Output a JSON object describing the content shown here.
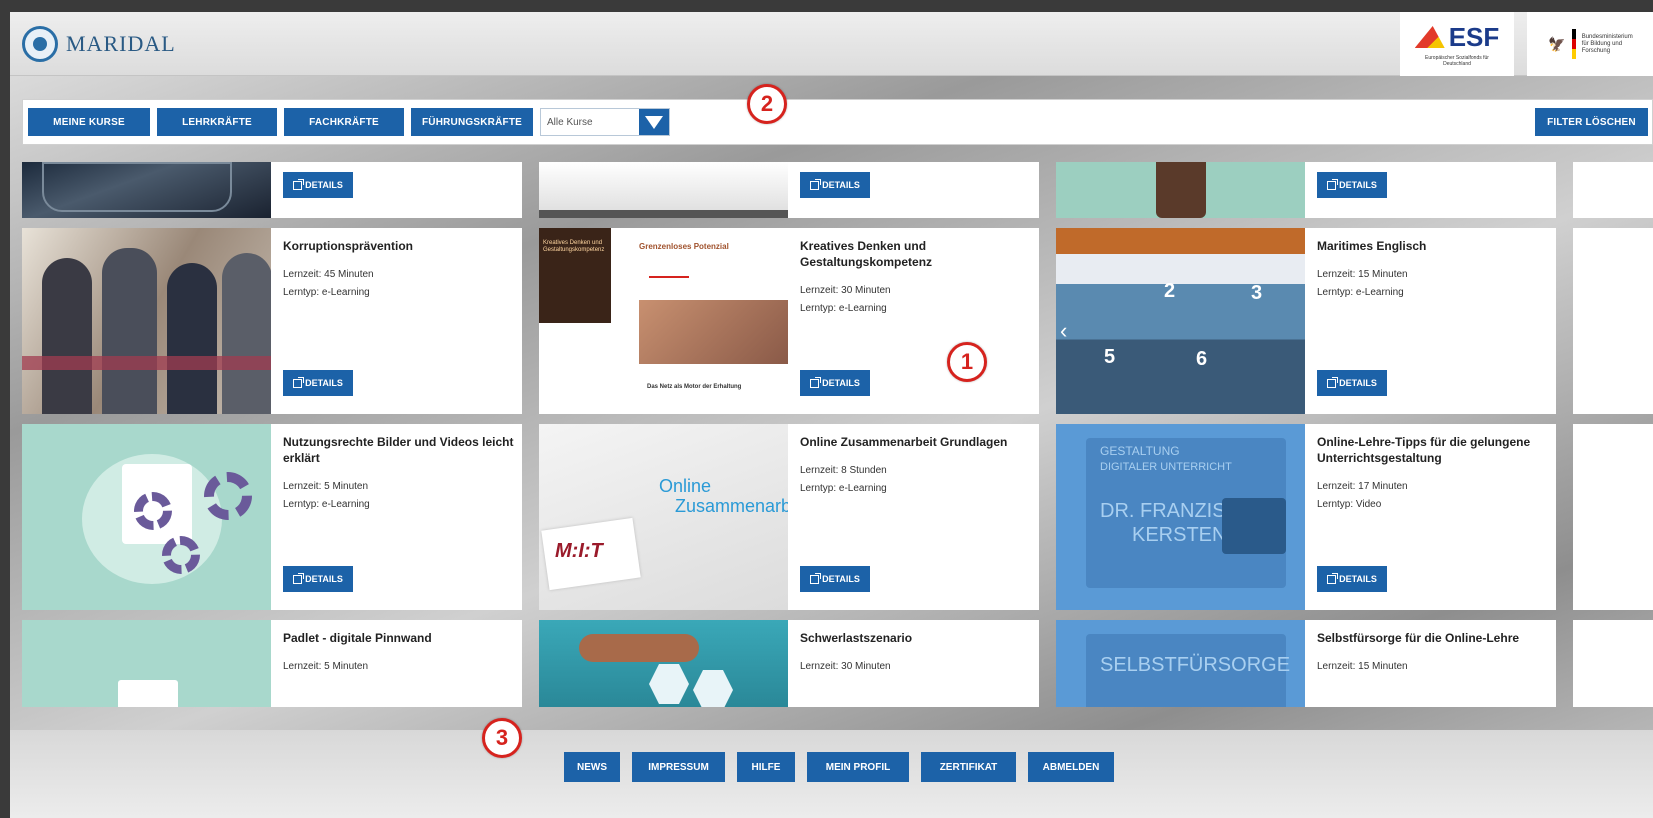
{
  "header": {
    "brand_name": "MARIDAL",
    "esf_logo": "ESF",
    "esf_subtitle": "Europäischer Sozialfonds für Deutschland",
    "bmbf_text": "Bundesministerium für Bildung und Forschung"
  },
  "filters": {
    "buttons": [
      "MEINE KURSE",
      "LEHRKRÄFTE",
      "FACHKRÄFTE",
      "FÜHRUNGSKRÄFTE"
    ],
    "select_value": "Alle Kurse",
    "clear_label": "FILTER LÖSCHEN"
  },
  "callouts": [
    "1",
    "2",
    "3"
  ],
  "details_label": "DETAILS",
  "courses": [
    {
      "title": "",
      "duration": "",
      "type": ""
    },
    {
      "title": "",
      "duration": "",
      "type": ""
    },
    {
      "title": "",
      "duration": "",
      "type": ""
    },
    {
      "title": "Korruptionsprävention",
      "duration": "Lernzeit: 45 Minuten",
      "type": "Lerntyp: e-Learning"
    },
    {
      "title": "Kreatives Denken und Gestaltungskompetenz",
      "duration": "Lernzeit: 30 Minuten",
      "type": "Lerntyp: e-Learning"
    },
    {
      "title": "Maritimes Englisch",
      "duration": "Lernzeit: 15 Minuten",
      "type": "Lerntyp: e-Learning"
    },
    {
      "title": "Nutzungsrechte Bilder und Videos leicht erklärt",
      "duration": "Lernzeit: 5 Minuten",
      "type": "Lerntyp: e-Learning"
    },
    {
      "title": "Online Zusammenarbeit Grundlagen",
      "duration": "Lernzeit: 8 Stunden",
      "type": "Lerntyp: e-Learning"
    },
    {
      "title": "Online-Lehre-Tipps für die gelungene Unterrichtsgestaltung",
      "duration": "Lernzeit: 17 Minuten",
      "type": "Lerntyp: Video"
    },
    {
      "title": "Padlet - digitale Pinnwand",
      "duration": "Lernzeit: 5 Minuten",
      "type": ""
    },
    {
      "title": "Schwerlastszenario",
      "duration": "Lernzeit: 30 Minuten",
      "type": ""
    },
    {
      "title": "Selbstfürsorge für die Online-Lehre",
      "duration": "Lernzeit: 15 Minuten",
      "type": ""
    }
  ],
  "thumb_text": {
    "creative_heading": "Grenzenloses Potenzial",
    "creative_side": "Kreatives Denken und Gestaltungskompetenz",
    "creative_bottom": "Das Netz als Motor der Erhaltung",
    "online_line1": "Online",
    "online_line2": "Zusammenarb",
    "mit_logo": "M:I:T",
    "video_lines": [
      "GESTALTUNG",
      "DIGITALER UNTERRICHT",
      "DR. FRANZISKA",
      "KERSTEN"
    ],
    "self_care": "SELBSTFÜRSORGE",
    "harbor_numbers": [
      "2",
      "3",
      "5",
      "6"
    ]
  },
  "footer": {
    "buttons": [
      "NEWS",
      "IMPRESSUM",
      "HILFE",
      "MEIN PROFIL",
      "ZERTIFIKAT",
      "ABMELDEN"
    ]
  },
  "colors": {
    "accent": "#1c62a8",
    "callout": "#d6231e"
  }
}
